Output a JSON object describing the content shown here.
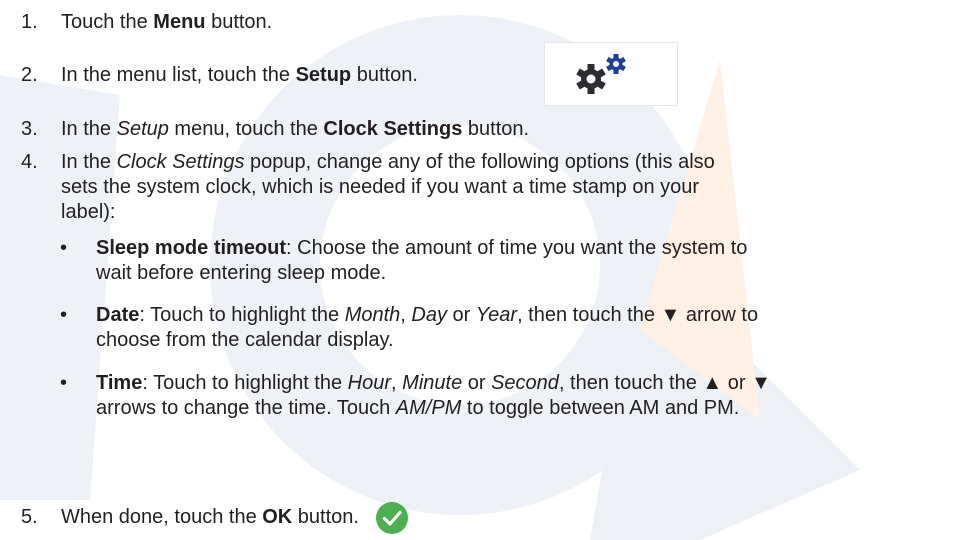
{
  "steps": {
    "s1": {
      "num": "1.",
      "a": "Touch the ",
      "b": "Menu",
      "c": " button."
    },
    "s2": {
      "num": "2.",
      "a": "In the menu list, touch the ",
      "b": "Setup",
      "c": " button."
    },
    "s3": {
      "num": "3.",
      "a": "In the ",
      "b": "Setup",
      "c": " menu, touch the ",
      "d": "Clock Settings",
      "e": " button."
    },
    "s4": {
      "num": "4.",
      "a": "In the ",
      "b": "Clock Settings",
      "c": " popup, change any of the following options (this also",
      "line2": "sets the system clock, which is needed if you want a time stamp on your",
      "line3": "label):"
    },
    "s5": {
      "num": "5.",
      "a": "When done, touch the ",
      "b": "OK",
      "c": " button."
    }
  },
  "bullets": {
    "bullet_char": "•",
    "sleep": {
      "term": "Sleep mode timeout",
      "line1": ": Choose the amount of time you want the system to",
      "line2": "wait before entering sleep mode."
    },
    "date": {
      "term": "Date",
      "a": ": Touch to highlight the ",
      "month": "Month",
      "b": ", ",
      "day": "Day",
      "c": " or ",
      "year": "Year",
      "d": ", then touch the ▼ arrow to",
      "line2": "choose from the calendar display."
    },
    "time": {
      "term": "Time",
      "a": ": Touch to highlight the ",
      "hour": "Hour",
      "b": ", ",
      "minute": "Minute",
      "c": " or ",
      "second": "Second",
      "d": ", then touch the ▲ or ▼",
      "line2a": "arrows to change the time. Touch ",
      "ampm": "AM/PM",
      "line2b": " to toggle between AM and PM."
    }
  },
  "icons": {
    "setup": "gear-icon",
    "ok": "check-circle-icon"
  },
  "colors": {
    "gear": "#2b2d31",
    "gear_small": "#1f3f8f",
    "ok": "#4caf50"
  }
}
